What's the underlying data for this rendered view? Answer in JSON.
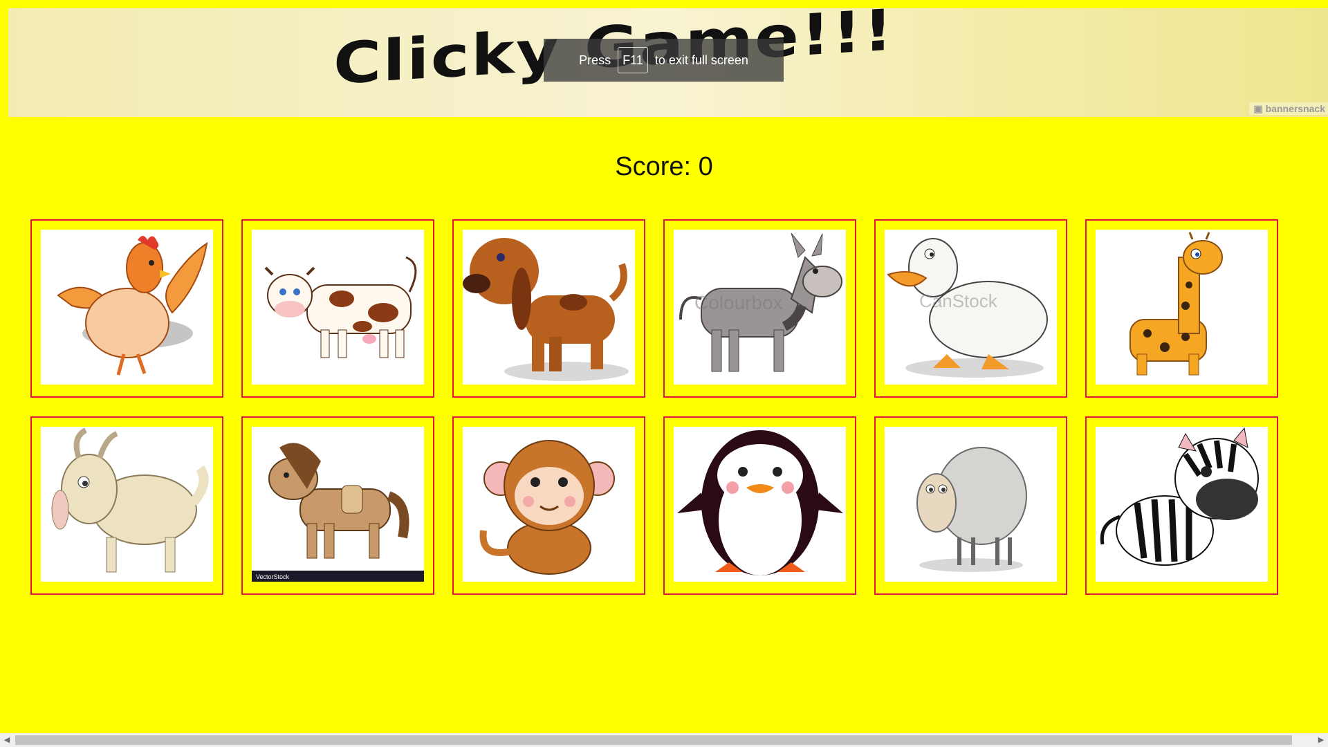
{
  "banner": {
    "title": "Clicky Game!!!",
    "brand": "bannersnack"
  },
  "fullscreen_notice": {
    "press": "Press",
    "key": "F11",
    "rest": "to exit full screen"
  },
  "score": {
    "text": "Score: 0"
  },
  "cards": [
    {
      "name": "chicken",
      "watermark": ""
    },
    {
      "name": "cow",
      "watermark": ""
    },
    {
      "name": "dog",
      "watermark": ""
    },
    {
      "name": "donkey",
      "watermark": "Colourbox"
    },
    {
      "name": "duck",
      "watermark": "CanStock"
    },
    {
      "name": "giraffe",
      "watermark": ""
    },
    {
      "name": "goat",
      "watermark": ""
    },
    {
      "name": "horse",
      "watermark": "VectorStock"
    },
    {
      "name": "monkey",
      "watermark": ""
    },
    {
      "name": "penguin",
      "watermark": ""
    },
    {
      "name": "sheep",
      "watermark": ""
    },
    {
      "name": "zebra",
      "watermark": ""
    }
  ],
  "colors": {
    "background": "#ffff00",
    "card_border": "#e0163c"
  }
}
